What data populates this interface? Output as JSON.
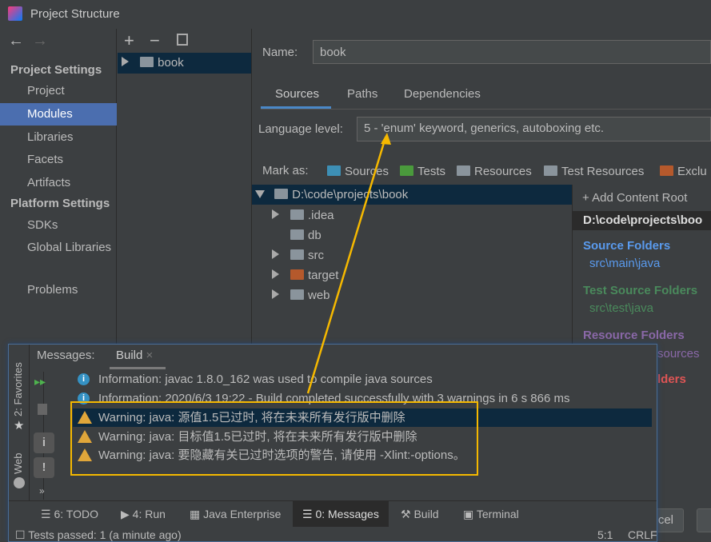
{
  "window": {
    "title": "Project Structure"
  },
  "sidebar": {
    "project_settings": "Project Settings",
    "items1": [
      "Project",
      "Modules",
      "Libraries",
      "Facets",
      "Artifacts"
    ],
    "platform_settings": "Platform Settings",
    "items2": [
      "SDKs",
      "Global Libraries"
    ],
    "problems": "Problems"
  },
  "modules": {
    "items": [
      "book"
    ]
  },
  "main": {
    "name_label": "Name:",
    "name_value": "book",
    "tabs": [
      "Sources",
      "Paths",
      "Dependencies"
    ],
    "lang_label": "Language level:",
    "lang_value": "5 - 'enum' keyword, generics, autoboxing etc.",
    "mark_as": "Mark as:",
    "marks": [
      "Sources",
      "Tests",
      "Resources",
      "Test Resources",
      "Exclu"
    ],
    "tree": {
      "root": "D:\\code\\projects\\book",
      "children": [
        ".idea",
        "db",
        "src",
        "target",
        "web"
      ]
    },
    "right": {
      "add": "Add Content Root",
      "path": "D:\\code\\projects\\boo",
      "source_h": "Source Folders",
      "source_v": "src\\main\\java",
      "test_h": "Test Source Folders",
      "test_v": "src\\test\\java",
      "res_h": "Resource Folders",
      "res_v": "sources",
      "excl_h": "lders"
    },
    "buttons": [
      "cel"
    ]
  },
  "messages": {
    "label": "Messages:",
    "tab": "Build",
    "lines": [
      {
        "type": "info",
        "text": "Information: javac 1.8.0_162 was used to compile java sources"
      },
      {
        "type": "info",
        "text": "Information: 2020/6/3 19:22 - Build completed successfully with 3 warnings in 6 s 866 ms"
      },
      {
        "type": "warning",
        "text": "Warning: java: 源值1.5已过时, 将在未来所有发行版中删除"
      },
      {
        "type": "warning",
        "text": "Warning: java: 目标值1.5已过时, 将在未来所有发行版中删除"
      },
      {
        "type": "warning",
        "text": "Warning: java: 要隐藏有关已过时选项的警告, 请使用 -Xlint:-options。"
      }
    ]
  },
  "side_tools": [
    "2: Favorites",
    "Web"
  ],
  "toolwindows": [
    "6: TODO",
    "4: Run",
    "Java Enterprise",
    "0: Messages",
    "Build",
    "Terminal"
  ],
  "status": {
    "text": "Tests passed: 1 (a minute ago)",
    "pos": "5:1",
    "eol": "CRLF"
  },
  "colors": {
    "selection": "#0d293e",
    "accent": "#4b6eaf",
    "annotation": "#f5b800"
  }
}
